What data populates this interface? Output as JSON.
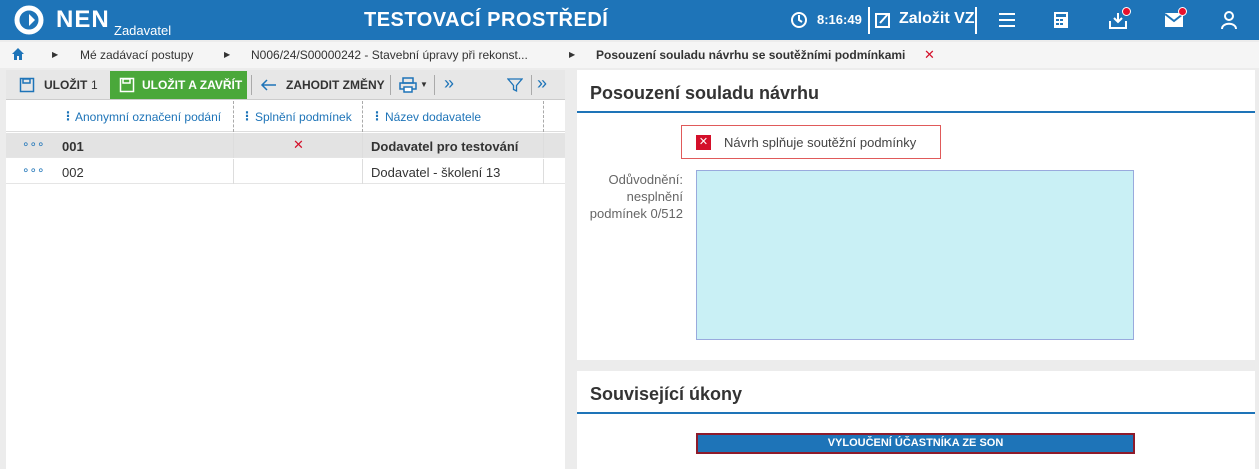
{
  "app": {
    "logo": "NEN",
    "logo_sub": "Zadavatel",
    "env_title": "TESTOVACÍ PROSTŘEDÍ",
    "time": "8:16:49",
    "create_label": "Založit VZ",
    "brand_color": "#1e74b8",
    "notification_color": "#e8112d"
  },
  "topbar_icons": [
    "clock-icon",
    "edit-icon",
    "menu-icon",
    "calculator-icon",
    "inbox-icon",
    "mail-icon",
    "user-icon"
  ],
  "breadcrumbs": {
    "items": [
      "Mé zadávací postupy",
      "N006/24/S00000242 - Stavební úpravy při rekonst...",
      "Posouzení souladu návrhu se soutěžními podmínkami"
    ],
    "close": "✕"
  },
  "toolbar": {
    "save": "ULOŽIT",
    "save_count": "1",
    "save_close": "ULOŽIT A ZAVŘÍT",
    "discard": "ZAHODIT ZMĚNY",
    "more": "»"
  },
  "table": {
    "columns": [
      "Anonymní označení podání",
      "Splnění podmínek",
      "Název dodavatele"
    ],
    "rows": [
      {
        "more": "∘∘∘",
        "id": "001",
        "met": "✕",
        "supplier": "Dodavatel pro testování"
      },
      {
        "more": "∘∘∘",
        "id": "002",
        "met": "",
        "supplier": "Dodavatel - školení 13"
      }
    ]
  },
  "assessment": {
    "title": "Posouzení souladu návrhu",
    "checkbox_icon": "✕",
    "checkbox_label": "Návrh splňuje soutěžní podmínky",
    "justification_label": "Odůvodnění: nesplnění podmínek 0/512",
    "justification_value": ""
  },
  "related": {
    "title": "Související úkony",
    "button": "VYLOUČENÍ ÚČASTNÍKA ZE SON"
  }
}
